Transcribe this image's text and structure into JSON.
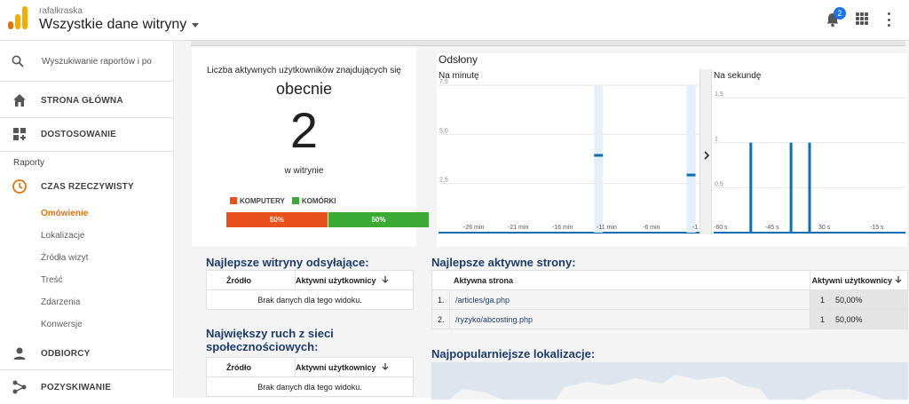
{
  "header": {
    "account": "rafalkraska",
    "property": "Wszystkie dane witryny",
    "notifications": "2"
  },
  "sidebar": {
    "search_placeholder": "Wyszukiwanie raportów i po",
    "home": "STRONA GŁÓWNA",
    "customization": "DOSTOSOWANIE",
    "reports_label": "Raporty",
    "realtime": "CZAS RZECZYWISTY",
    "realtime_items": [
      "Omówienie",
      "Lokalizacje",
      "Źródła wizyt",
      "Treść",
      "Zdarzenia",
      "Konwersje"
    ],
    "audience": "ODBIORCY",
    "acquisition": "POZYSKIWANIE"
  },
  "active_users": {
    "title": "Liczba aktywnych użytkowników znajdujących się",
    "now": "obecnie",
    "count": "2",
    "subtitle": "w witrynie",
    "desktop_label": "KOMPUTERY",
    "mobile_label": "KOMÓRKI",
    "desktop_pct_label": "50%",
    "mobile_pct_label": "50%",
    "desktop_fraction": 0.5,
    "desktop_color": "#e8501e",
    "mobile_color": "#3aaa35"
  },
  "views": {
    "title": "Odsłony"
  },
  "chart_data": [
    {
      "type": "bar",
      "title": "Na minutę",
      "yticks": [
        "7,5",
        "5,0",
        "2,5"
      ],
      "ylim": [
        0,
        7.5
      ],
      "xticks": [
        "-26 min",
        "-21 min",
        "-16 min",
        "-11 min",
        "-6 min",
        "-1"
      ],
      "x": [
        -30,
        -29,
        -28,
        -27,
        -26,
        -25,
        -24,
        -23,
        -22,
        -21,
        -20,
        -19,
        -18,
        -17,
        -16,
        -15,
        -14,
        -13,
        -12,
        -11,
        -10,
        -9,
        -8,
        -7,
        -6,
        -5,
        -4,
        -3,
        -2,
        -1
      ],
      "values": [
        0,
        0,
        0,
        0,
        0,
        0,
        0,
        0,
        0,
        0,
        0,
        0,
        0,
        0,
        0,
        0,
        0,
        0,
        4,
        0,
        0,
        0,
        0,
        0,
        0,
        0,
        0,
        0,
        0,
        3
      ],
      "color": "#0f6fb5"
    },
    {
      "type": "bar",
      "title": "Na sekundę",
      "yticks": [
        "1,5",
        "1",
        "0,5"
      ],
      "ylim": [
        0,
        1.5
      ],
      "xticks": [
        "-60 s",
        "-45 s",
        "30 s",
        "-15 s"
      ],
      "x": [
        -50,
        -37,
        -31
      ],
      "values": [
        1,
        1,
        1
      ],
      "color": "#0f6fb5"
    }
  ],
  "referrals": {
    "title": "Najlepsze witryny odsyłające:",
    "col_source": "Źródło",
    "col_users": "Aktywni użytkownicy",
    "empty": "Brak danych dla tego widoku."
  },
  "social": {
    "title_line1": "Największy ruch z sieci",
    "title_line2": "społecznościowych:",
    "col_source": "Źródło",
    "col_users": "Aktywni użytkownicy",
    "empty": "Brak danych dla tego widoku."
  },
  "top_pages": {
    "title": "Najlepsze aktywne strony:",
    "col_page": "Aktywna strona",
    "col_users": "Aktywni użytkownicy",
    "rows": [
      {
        "idx": "1.",
        "page": "/articles/ga.php",
        "users": "1",
        "pct": "50,00%"
      },
      {
        "idx": "2.",
        "page": "/ryzyko/abcosting.php",
        "users": "1",
        "pct": "50,00%"
      }
    ]
  },
  "locations": {
    "title": "Najpopularniejsze lokalizacje:"
  }
}
